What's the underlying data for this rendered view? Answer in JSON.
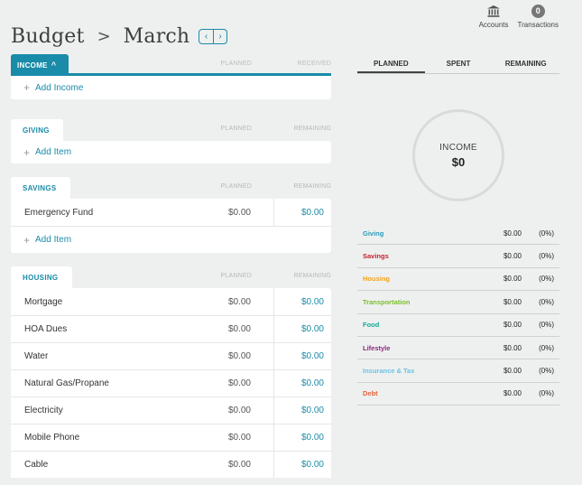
{
  "header": {
    "title": "Budget",
    "separator": ">",
    "month": "March",
    "prev": "‹",
    "next": "›"
  },
  "topnav": {
    "accounts_label": "Accounts",
    "transactions_label": "Transactions",
    "transactions_count": "0"
  },
  "income": {
    "tab_label": "INCOME",
    "chevron": "^",
    "col_planned": "PLANNED",
    "col_received": "RECEIVED",
    "add_label": "Add Income"
  },
  "giving": {
    "tab_label": "GIVING",
    "col_planned": "PLANNED",
    "col_remaining": "REMAINING",
    "add_label": "Add Item"
  },
  "savings": {
    "tab_label": "SAVINGS",
    "col_planned": "PLANNED",
    "col_remaining": "REMAINING",
    "rows": [
      {
        "name": "Emergency Fund",
        "planned": "$0.00",
        "remaining": "$0.00"
      }
    ],
    "add_label": "Add Item"
  },
  "housing": {
    "tab_label": "HOUSING",
    "col_planned": "PLANNED",
    "col_remaining": "REMAINING",
    "rows": [
      {
        "name": "Mortgage",
        "planned": "$0.00",
        "remaining": "$0.00"
      },
      {
        "name": "HOA Dues",
        "planned": "$0.00",
        "remaining": "$0.00"
      },
      {
        "name": "Water",
        "planned": "$0.00",
        "remaining": "$0.00"
      },
      {
        "name": "Natural Gas/Propane",
        "planned": "$0.00",
        "remaining": "$0.00"
      },
      {
        "name": "Electricity",
        "planned": "$0.00",
        "remaining": "$0.00"
      },
      {
        "name": "Mobile Phone",
        "planned": "$0.00",
        "remaining": "$0.00"
      },
      {
        "name": "Cable",
        "planned": "$0.00",
        "remaining": "$0.00"
      }
    ]
  },
  "summary": {
    "tabs": [
      "PLANNED",
      "SPENT",
      "REMAINING"
    ],
    "active_tab": "PLANNED",
    "donut_label": "INCOME",
    "donut_value": "$0",
    "categories": [
      {
        "name": "Giving",
        "amount": "$0.00",
        "pct": "(0%)",
        "color": "#2b9bb8"
      },
      {
        "name": "Savings",
        "amount": "$0.00",
        "pct": "(0%)",
        "color": "#c8202f"
      },
      {
        "name": "Housing",
        "amount": "$0.00",
        "pct": "(0%)",
        "color": "#f0a31c"
      },
      {
        "name": "Transportation",
        "amount": "$0.00",
        "pct": "(0%)",
        "color": "#7cbf2d"
      },
      {
        "name": "Food",
        "amount": "$0.00",
        "pct": "(0%)",
        "color": "#1aa896"
      },
      {
        "name": "Lifestyle",
        "amount": "$0.00",
        "pct": "(0%)",
        "color": "#8a2a7c"
      },
      {
        "name": "Insurance & Tax",
        "amount": "$0.00",
        "pct": "(0%)",
        "color": "#6cc2e6"
      },
      {
        "name": "Debt",
        "amount": "$0.00",
        "pct": "(0%)",
        "color": "#e2643b"
      }
    ]
  }
}
